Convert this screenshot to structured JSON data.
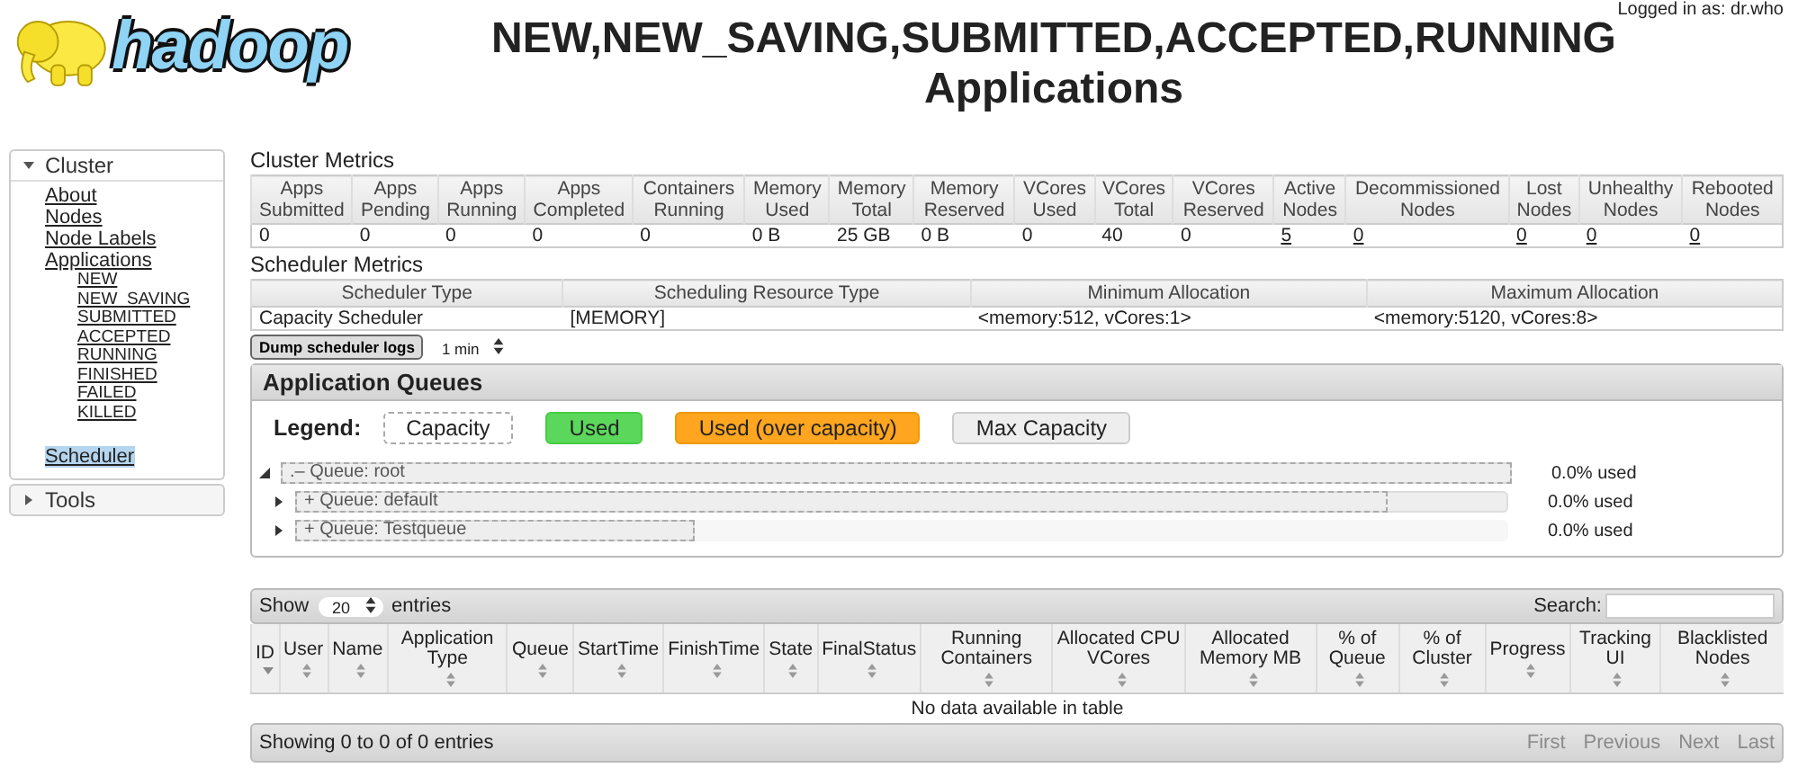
{
  "header": {
    "logo_text": "hadoop",
    "title": "NEW,NEW_SAVING,SUBMITTED,ACCEPTED,RUNNING Applications",
    "logged_in": "Logged in as: dr.who"
  },
  "sidebar": [
    {
      "label": "Cluster",
      "expanded": true,
      "items": [
        {
          "label": "About",
          "selected": false
        },
        {
          "label": "Nodes",
          "selected": false
        },
        {
          "label": "Node Labels",
          "selected": false
        },
        {
          "label": "Applications",
          "selected": false,
          "children": [
            {
              "label": "NEW",
              "selected": false
            },
            {
              "label": "NEW_SAVING",
              "selected": false
            },
            {
              "label": "SUBMITTED",
              "selected": false
            },
            {
              "label": "ACCEPTED",
              "selected": false
            },
            {
              "label": "RUNNING",
              "selected": false
            },
            {
              "label": "FINISHED",
              "selected": false
            },
            {
              "label": "FAILED",
              "selected": false
            },
            {
              "label": "KILLED",
              "selected": false
            }
          ]
        },
        {
          "label": "Scheduler",
          "selected": true
        }
      ]
    },
    {
      "label": "Tools",
      "expanded": false
    }
  ],
  "cluster_metrics": {
    "title": "Cluster Metrics",
    "columns": [
      {
        "header": "Apps Submitted",
        "value": "0",
        "link": false
      },
      {
        "header": "Apps Pending",
        "value": "0",
        "link": false
      },
      {
        "header": "Apps Running",
        "value": "0",
        "link": false
      },
      {
        "header": "Apps Completed",
        "value": "0",
        "link": false
      },
      {
        "header": "Containers Running",
        "value": "0",
        "link": false
      },
      {
        "header": "Memory Used",
        "value": "0 B",
        "link": false
      },
      {
        "header": "Memory Total",
        "value": "25 GB",
        "link": false
      },
      {
        "header": "Memory Reserved",
        "value": "0 B",
        "link": false
      },
      {
        "header": "VCores Used",
        "value": "0",
        "link": false
      },
      {
        "header": "VCores Total",
        "value": "40",
        "link": false
      },
      {
        "header": "VCores Reserved",
        "value": "0",
        "link": false
      },
      {
        "header": "Active Nodes",
        "value": "5",
        "link": true
      },
      {
        "header": "Decommissioned Nodes",
        "value": "0",
        "link": true
      },
      {
        "header": "Lost Nodes",
        "value": "0",
        "link": true
      },
      {
        "header": "Unhealthy Nodes",
        "value": "0",
        "link": true
      },
      {
        "header": "Rebooted Nodes",
        "value": "0",
        "link": true
      }
    ]
  },
  "scheduler_metrics": {
    "title": "Scheduler Metrics",
    "columns": [
      {
        "header": "Scheduler Type",
        "value": "Capacity Scheduler"
      },
      {
        "header": "Scheduling Resource Type",
        "value": "[MEMORY]"
      },
      {
        "header": "Minimum Allocation",
        "value": "<memory:512, vCores:1>"
      },
      {
        "header": "Maximum Allocation",
        "value": "<memory:5120, vCores:8>"
      }
    ]
  },
  "dump_button": "Dump scheduler logs",
  "dump_interval": "1 min",
  "queues": {
    "title": "Application Queues",
    "legend_label": "Legend:",
    "legend": [
      {
        "label": "Capacity",
        "kind": "capacity"
      },
      {
        "label": "Used",
        "kind": "used"
      },
      {
        "label": "Used (over capacity)",
        "kind": "over"
      },
      {
        "label": "Max Capacity",
        "kind": "max"
      }
    ],
    "tree": [
      {
        "label": "Queue: root",
        "sign": ".–",
        "expanded": true,
        "used": "0.0% used",
        "max_capacity": {
          "level": 1
        },
        "capacity": {
          "level": 1
        },
        "children": [
          {
            "label": "Queue: default",
            "sign": "+",
            "expanded": false,
            "used": "0.0% used",
            "max_capacity": {
              "level": 1
            },
            "capacity": {
              "level": 0.9
            }
          },
          {
            "label": "Queue: Testqueue",
            "sign": "+",
            "expanded": false,
            "used": "0.0% used",
            "max_capacity": {
              "level": 0.33
            },
            "capacity": {
              "level": 0.33
            }
          }
        ]
      }
    ]
  },
  "apps_table": {
    "show_label": "Show",
    "page_size": "20",
    "entries_label": "entries",
    "search_label": "Search:",
    "columns": [
      {
        "label": "ID",
        "kind": "sorted"
      },
      {
        "label": "User",
        "kind": "sortable"
      },
      {
        "label": "Name",
        "kind": "sortable"
      },
      {
        "label": "Application Type",
        "kind": "sortable"
      },
      {
        "label": "Queue",
        "kind": "sortable"
      },
      {
        "label": "StartTime",
        "kind": "sortable"
      },
      {
        "label": "FinishTime",
        "kind": "sortable"
      },
      {
        "label": "State",
        "kind": "sortable"
      },
      {
        "label": "FinalStatus",
        "kind": "sortable"
      },
      {
        "label": "Running Containers",
        "kind": "sortable"
      },
      {
        "label": "Allocated CPU VCores",
        "kind": "sortable"
      },
      {
        "label": "Allocated Memory MB",
        "kind": "sortable"
      },
      {
        "label": "% of Queue",
        "kind": "sortable"
      },
      {
        "label": "% of Cluster",
        "kind": "sortable"
      },
      {
        "label": "Progress",
        "kind": "sortable"
      },
      {
        "label": "Tracking UI",
        "kind": "sortable"
      },
      {
        "label": "Blacklisted Nodes",
        "kind": "sortable"
      }
    ],
    "empty": "No data available in table",
    "info": "Showing 0 to 0 of 0 entries",
    "pager": [
      {
        "label": "First",
        "disabled": true
      },
      {
        "label": "Previous",
        "disabled": true
      },
      {
        "label": "Next",
        "disabled": true
      },
      {
        "label": "Last",
        "disabled": true
      }
    ]
  }
}
